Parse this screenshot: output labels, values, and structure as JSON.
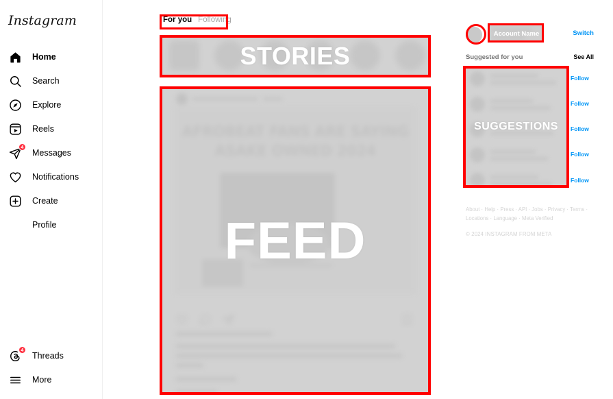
{
  "brand": {
    "logo_text": "Instagram",
    "accent_blue": "#0095f6",
    "annotation_red": "#ff0000",
    "badge_red": "#ff3040"
  },
  "sidebar": {
    "items": [
      {
        "label": "Home",
        "icon": "home-icon",
        "active": true,
        "badge": ""
      },
      {
        "label": "Search",
        "icon": "search-icon",
        "active": false,
        "badge": ""
      },
      {
        "label": "Explore",
        "icon": "compass-icon",
        "active": false,
        "badge": ""
      },
      {
        "label": "Reels",
        "icon": "reels-icon",
        "active": false,
        "badge": ""
      },
      {
        "label": "Messages",
        "icon": "paper-plane-icon",
        "active": false,
        "badge": "4"
      },
      {
        "label": "Notifications",
        "icon": "heart-icon",
        "active": false,
        "badge": ""
      },
      {
        "label": "Create",
        "icon": "plus-square-icon",
        "active": false,
        "badge": ""
      },
      {
        "label": "Profile",
        "icon": "",
        "active": false,
        "badge": ""
      }
    ],
    "bottom_items": [
      {
        "label": "Threads",
        "icon": "threads-icon",
        "badge": "4"
      },
      {
        "label": "More",
        "icon": "hamburger-icon",
        "badge": ""
      }
    ]
  },
  "feed_tabs": {
    "selected": "For you",
    "unselected": "Following"
  },
  "stories": {
    "overlay_label": "STORIES"
  },
  "feed": {
    "overlay_label": "FEED",
    "post_headline_line1": "AFROBEAT FANS ARE SAYING",
    "post_headline_line2": "ASAKE OWNED 2024"
  },
  "rail": {
    "account_overlay_label": "Account Name",
    "switch_label": "Switch",
    "suggested_title": "Suggested for you",
    "see_all_label": "See All",
    "suggestions_overlay_label": "SUGGESTIONS",
    "follow_labels": [
      "Follow",
      "Follow",
      "Follow",
      "Follow",
      "Follow"
    ]
  },
  "footer": {
    "links": [
      "About",
      "Help",
      "Press",
      "API",
      "Jobs",
      "Privacy",
      "Terms",
      "Locations",
      "Language",
      "Meta Verified"
    ],
    "separator": " · ",
    "copyright": "© 2024 INSTAGRAM FROM META"
  }
}
